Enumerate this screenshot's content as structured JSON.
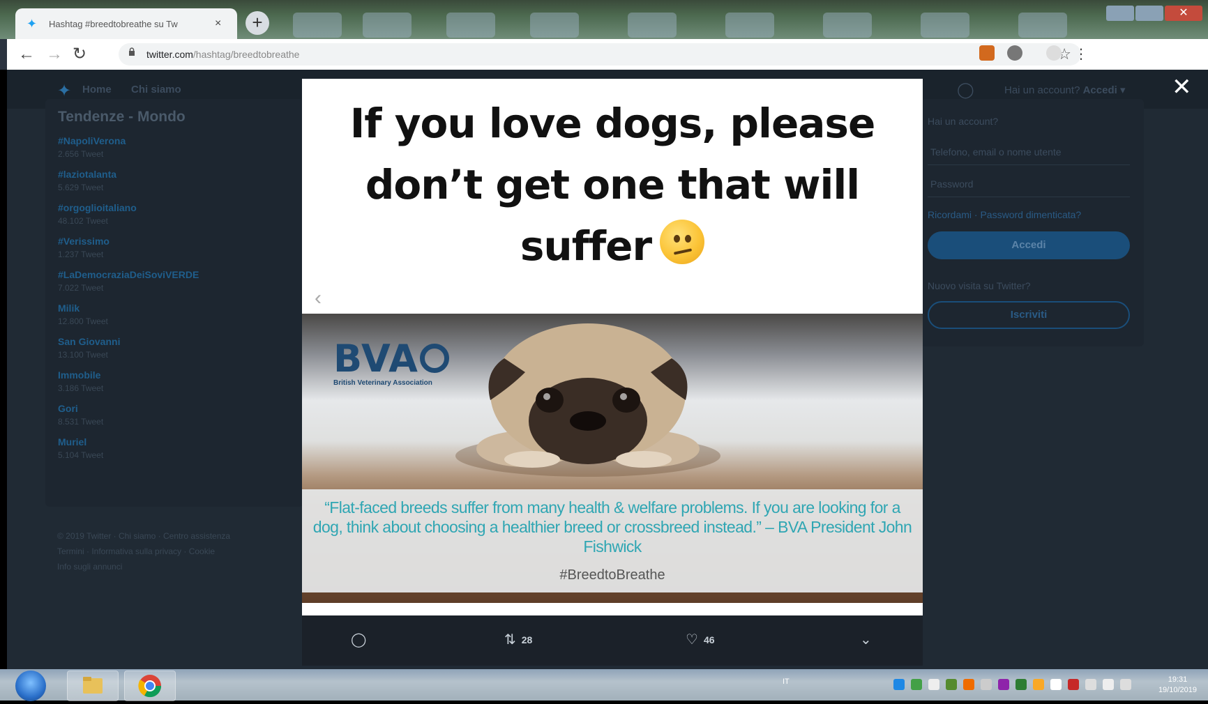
{
  "browser": {
    "tab_title": "Hashtag #breedtobreathe su Tw",
    "tab_close": "×",
    "new_tab": "+",
    "url_host": "twitter.com",
    "url_path": "/hashtag/breedtobreathe"
  },
  "twitter": {
    "nav": {
      "home": "Home",
      "about": "Chi siamo"
    },
    "account_prompt": "Hai un account?",
    "login_label": "Accedi",
    "trends_title": "Tendenze - Mondo",
    "trends": [
      {
        "tag": "#NapoliVerona",
        "count": "2.656 Tweet"
      },
      {
        "tag": "#laziotalanta",
        "count": "5.629 Tweet"
      },
      {
        "tag": "#orgoglioitaliano",
        "count": "48.102 Tweet"
      },
      {
        "tag": "#Verissimo",
        "count": "1.237 Tweet"
      },
      {
        "tag": "#LaDemocraziaDeiSoviVERDE",
        "count": "7.022 Tweet"
      },
      {
        "tag": "Milik",
        "count": "12.800 Tweet"
      },
      {
        "tag": "San Giovanni",
        "count": "13.100 Tweet"
      },
      {
        "tag": "Immobile",
        "count": "3.186 Tweet"
      },
      {
        "tag": "Gori",
        "count": "8.531 Tweet"
      },
      {
        "tag": "Muriel",
        "count": "5.104 Tweet"
      }
    ],
    "footer_lines": [
      "© 2019 Twitter · Chi siamo · Centro assistenza",
      "Termini · Informativa sulla privacy · Cookie",
      "Info sugli annunci"
    ],
    "login_box": {
      "have_account": "Hai un account?",
      "user_placeholder": "Telefono, email o nome utente",
      "password_placeholder": "Password",
      "remember": "Ricordami · Password dimenticata?",
      "login_button": "Accedi",
      "new_prompt": "Nuovo visita su Twitter?",
      "signup_button": "Iscriviti"
    }
  },
  "modal": {
    "close": "✕",
    "prev": "‹",
    "headline_line1": "If you love dogs, please",
    "headline_line2": "don’t get one that will",
    "headline_line3": "suffer",
    "emoji": "confused-face",
    "bva_letters": "BVA",
    "bva_subtitle": "British Veterinary Association",
    "quote": "“Flat-faced breeds suffer from many health & welfare problems. If you are looking for a dog, think about choosing a healthier breed or crossbreed instead.”  – BVA President John Fishwick",
    "hashtag": "#BreedtoBreathe",
    "retweets": "28",
    "likes": "46"
  },
  "taskbar": {
    "lang": "IT",
    "time": "19:31",
    "date": "19/10/2019"
  },
  "colors": {
    "twitter_blue": "#1da1f2",
    "bva_navy": "#1f4a73",
    "quote_teal": "#2fa6b3"
  }
}
